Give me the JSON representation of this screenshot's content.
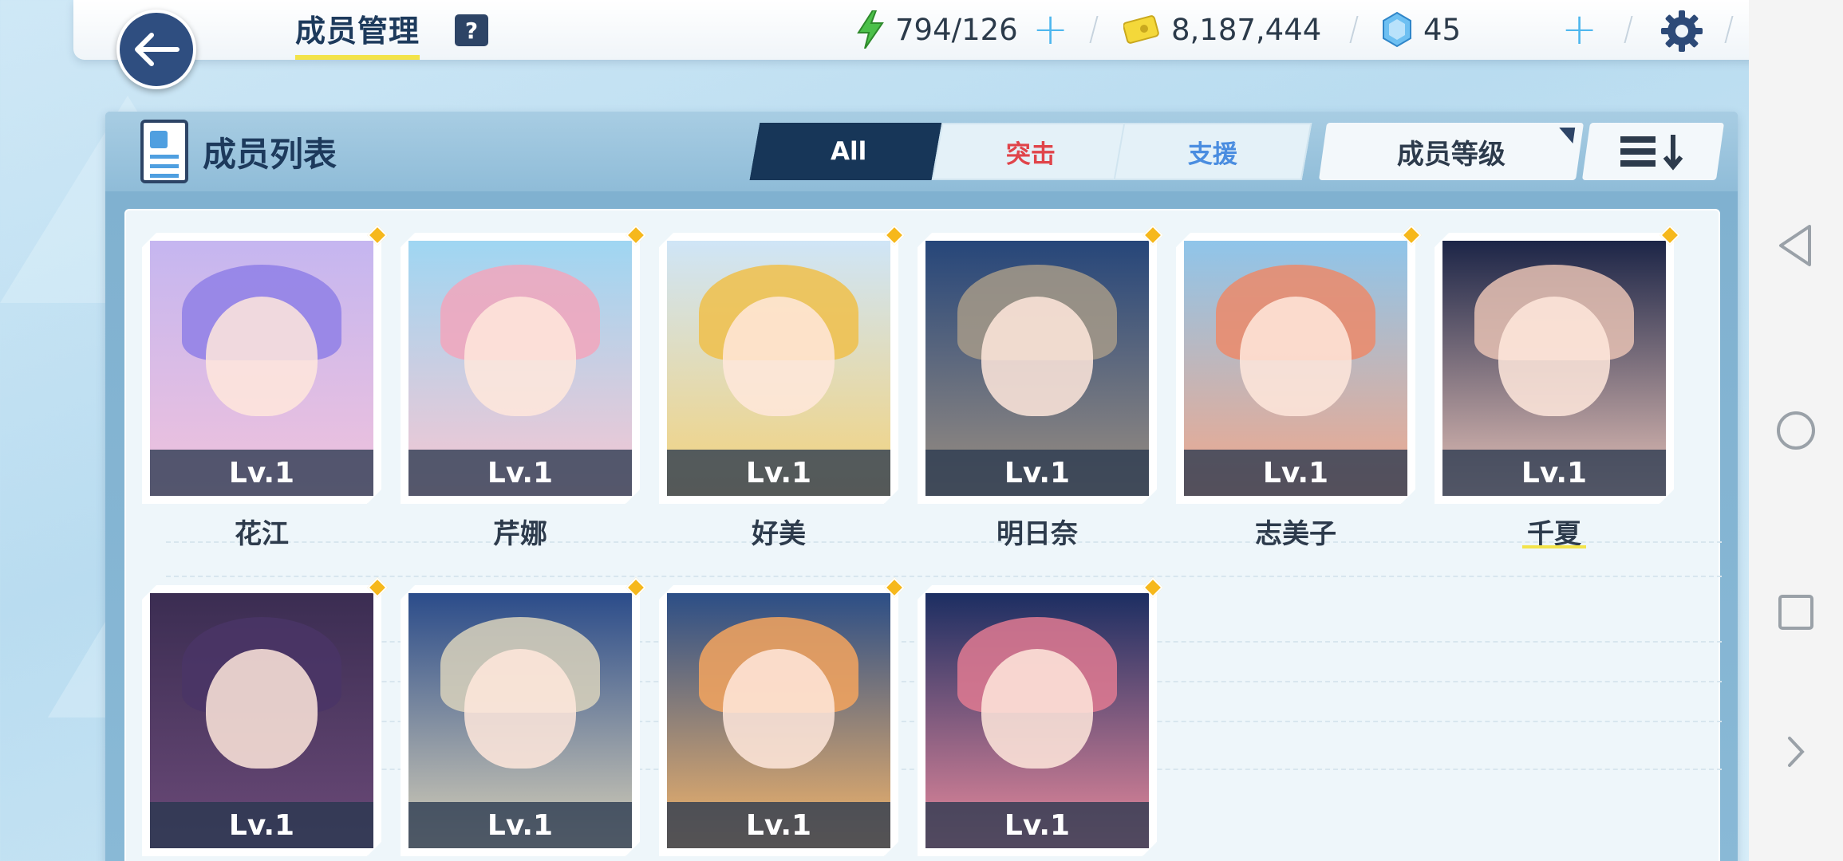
{
  "header": {
    "title": "成员管理",
    "help": "?",
    "energy": "794/126",
    "credits": "8,187,444",
    "gems": "45"
  },
  "panel": {
    "title": "成员列表",
    "tabs": [
      "All",
      "突击",
      "支援"
    ],
    "sort_label": "成员等级"
  },
  "members": [
    {
      "name": "花江",
      "level": "Lv.1"
    },
    {
      "name": "芹娜",
      "level": "Lv.1"
    },
    {
      "name": "好美",
      "level": "Lv.1"
    },
    {
      "name": "明日奈",
      "level": "Lv.1"
    },
    {
      "name": "志美子",
      "level": "Lv.1"
    },
    {
      "name": "千夏",
      "level": "Lv.1"
    },
    {
      "name": "",
      "level": "Lv.1"
    },
    {
      "name": "",
      "level": "Lv.1"
    },
    {
      "name": "",
      "level": "Lv.1"
    },
    {
      "name": "",
      "level": "Lv.1"
    }
  ],
  "colors": {
    "accent": "#173658",
    "assault": "#e0444a",
    "support": "#4a8de0",
    "highlight": "#f3e34a"
  }
}
